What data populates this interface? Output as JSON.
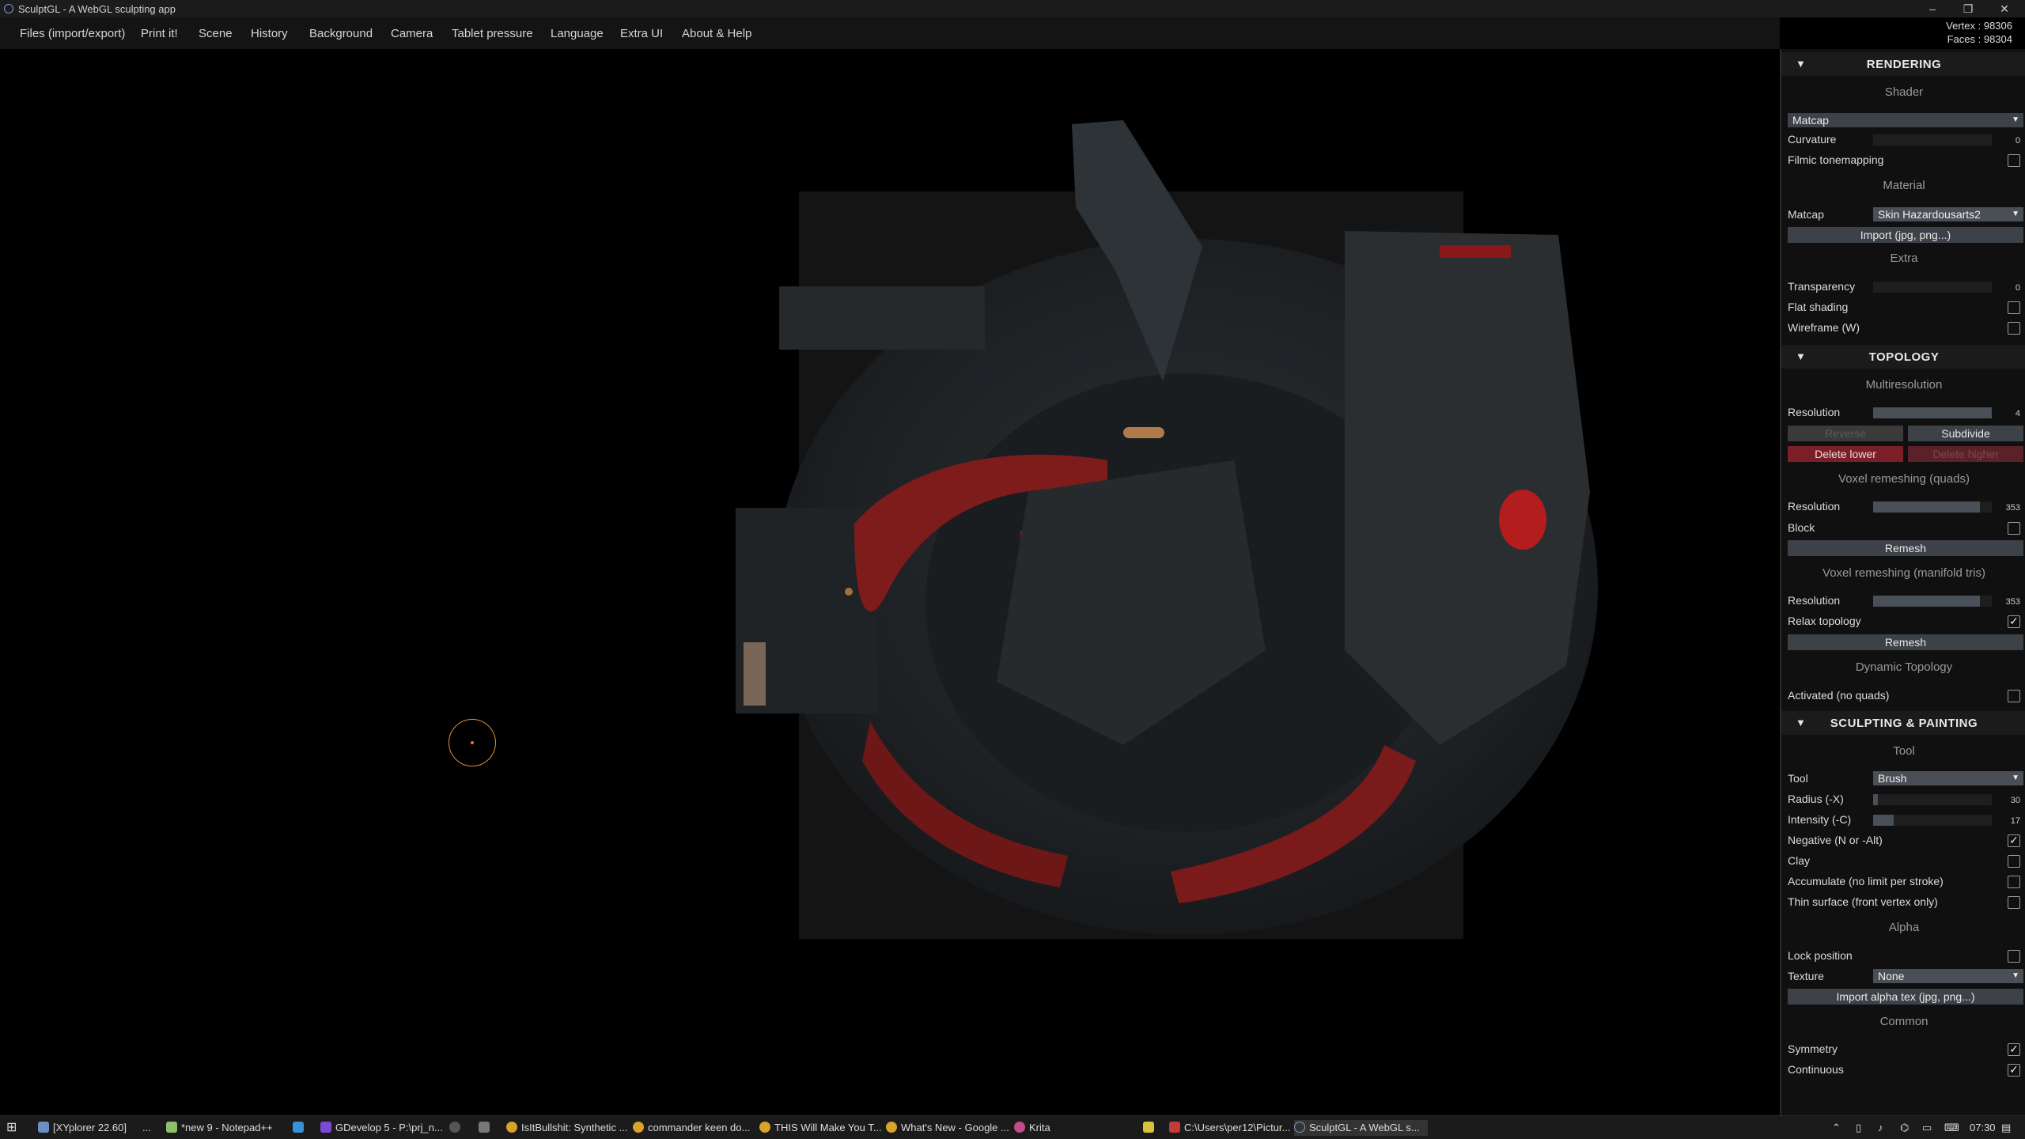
{
  "window": {
    "title": "SculptGL - A WebGL sculpting app",
    "controls": [
      "–",
      "❐",
      "✕"
    ]
  },
  "menu": [
    "Files (import/export)",
    "Print it!",
    "Scene",
    "History",
    "Background",
    "Camera",
    "Tablet pressure",
    "Language",
    "Extra UI",
    "About & Help"
  ],
  "stats": {
    "vertex": "Vertex : 98306",
    "faces": "Faces : 98304"
  },
  "rendering": {
    "header": "RENDERING",
    "shader_title": "Shader",
    "shader_value": "Matcap",
    "curvature_label": "Curvature",
    "curvature_value": "0",
    "filmic_label": "Filmic tonemapping",
    "material_title": "Material",
    "matcap_label": "Matcap",
    "matcap_value": "Skin Hazardousarts2",
    "import_label": "Import (jpg, png...)",
    "extra_title": "Extra",
    "transparency_label": "Transparency",
    "transparency_value": "0",
    "flat_label": "Flat shading",
    "wireframe_label": "Wireframe (W)"
  },
  "topology": {
    "header": "TOPOLOGY",
    "multires_title": "Multiresolution",
    "resolution_label": "Resolution",
    "resolution_value": "4",
    "reverse_label": "Reverse",
    "subdivide_label": "Subdivide",
    "delete_lower_label": "Delete lower",
    "delete_higher_label": "Delete higher",
    "voxel_quads_title": "Voxel remeshing (quads)",
    "voxel_res_label": "Resolution",
    "voxel_res_value": "353",
    "block_label": "Block",
    "remesh_label": "Remesh",
    "voxel_tris_title": "Voxel remeshing (manifold tris)",
    "tris_res_label": "Resolution",
    "tris_res_value": "353",
    "relax_label": "Relax topology",
    "remesh2_label": "Remesh",
    "dyntopo_title": "Dynamic Topology",
    "activated_label": "Activated (no quads)"
  },
  "sculpting": {
    "header": "SCULPTING & PAINTING",
    "tool_title": "Tool",
    "tool_label": "Tool",
    "tool_value": "Brush",
    "radius_label": "Radius (-X)",
    "radius_value": "30",
    "intensity_label": "Intensity (-C)",
    "intensity_value": "17",
    "negative_label": "Negative (N or -Alt)",
    "clay_label": "Clay",
    "accumulate_label": "Accumulate (no limit per stroke)",
    "thin_label": "Thin surface (front vertex only)",
    "alpha_title": "Alpha",
    "lock_label": "Lock position",
    "texture_label": "Texture",
    "texture_value": "None",
    "import_alpha_label": "Import alpha tex (jpg, png...)",
    "common_title": "Common",
    "symmetry_label": "Symmetry",
    "continuous_label": "Continuous"
  },
  "checks": {
    "filmic": false,
    "flat": false,
    "wireframe": false,
    "block": false,
    "relax": true,
    "activated": false,
    "negative": true,
    "clay": false,
    "accumulate": false,
    "thin": false,
    "lock": false,
    "symmetry": true,
    "continuous": true,
    "mark": "✓"
  },
  "taskbar": {
    "items": [
      "[XYplorer 22.60]",
      "...",
      "*new 9 - Notepad++",
      "GDevelop 5 - P:\\prj_n...",
      "IsItBullshit: Synthetic ...",
      "commander keen do...",
      "THIS Will Make You T...",
      "What's New - Google ...",
      "Krita",
      "C:\\Users\\per12\\Pictur...",
      "SculptGL - A WebGL s..."
    ],
    "time": "07:30"
  },
  "colors": {
    "accent_red": "#7a1f28",
    "panel_bg": "#101010",
    "button_bg": "#3d4249",
    "cursor_ring": "#e38b3a"
  }
}
